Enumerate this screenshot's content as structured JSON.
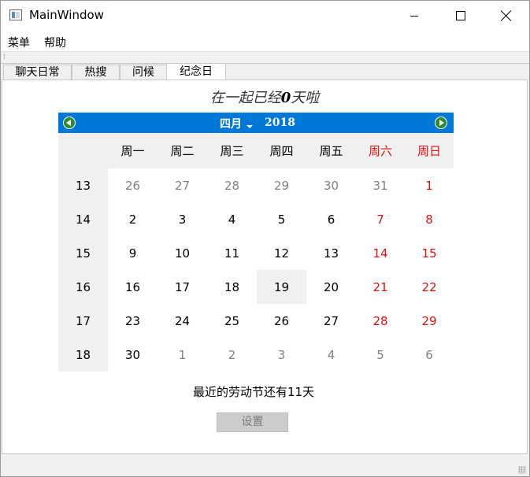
{
  "window": {
    "title": "MainWindow"
  },
  "menubar": {
    "items": [
      "菜单",
      "帮助"
    ]
  },
  "tabs": [
    {
      "label": "聊天日常",
      "active": false
    },
    {
      "label": "热搜",
      "active": false
    },
    {
      "label": "问候",
      "active": false
    },
    {
      "label": "纪念日",
      "active": true
    }
  ],
  "anniversary": {
    "together_prefix": "在一起已经",
    "together_days": "0",
    "together_suffix": "天啦",
    "holiday_text": "最近的劳动节还有11天",
    "set_button": "设置"
  },
  "calendar": {
    "month": "四月",
    "year": "2018",
    "weekdays": [
      "周一",
      "周二",
      "周三",
      "周四",
      "周五",
      "周六",
      "周日"
    ],
    "weeks": [
      {
        "week": "13",
        "days": [
          "26",
          "27",
          "28",
          "29",
          "30",
          "31",
          "1"
        ]
      },
      {
        "week": "14",
        "days": [
          "2",
          "3",
          "4",
          "5",
          "6",
          "7",
          "8"
        ]
      },
      {
        "week": "15",
        "days": [
          "9",
          "10",
          "11",
          "12",
          "13",
          "14",
          "15"
        ]
      },
      {
        "week": "16",
        "days": [
          "16",
          "17",
          "18",
          "19",
          "20",
          "21",
          "22"
        ]
      },
      {
        "week": "17",
        "days": [
          "23",
          "24",
          "25",
          "26",
          "27",
          "28",
          "29"
        ]
      },
      {
        "week": "18",
        "days": [
          "30",
          "1",
          "2",
          "3",
          "4",
          "5",
          "6"
        ]
      }
    ],
    "selected_day": "19",
    "colors": {
      "header": "#0078d7",
      "weekend": "#e01010",
      "other_month": "#808080",
      "nav_arrow": "#2e8b2e"
    }
  }
}
